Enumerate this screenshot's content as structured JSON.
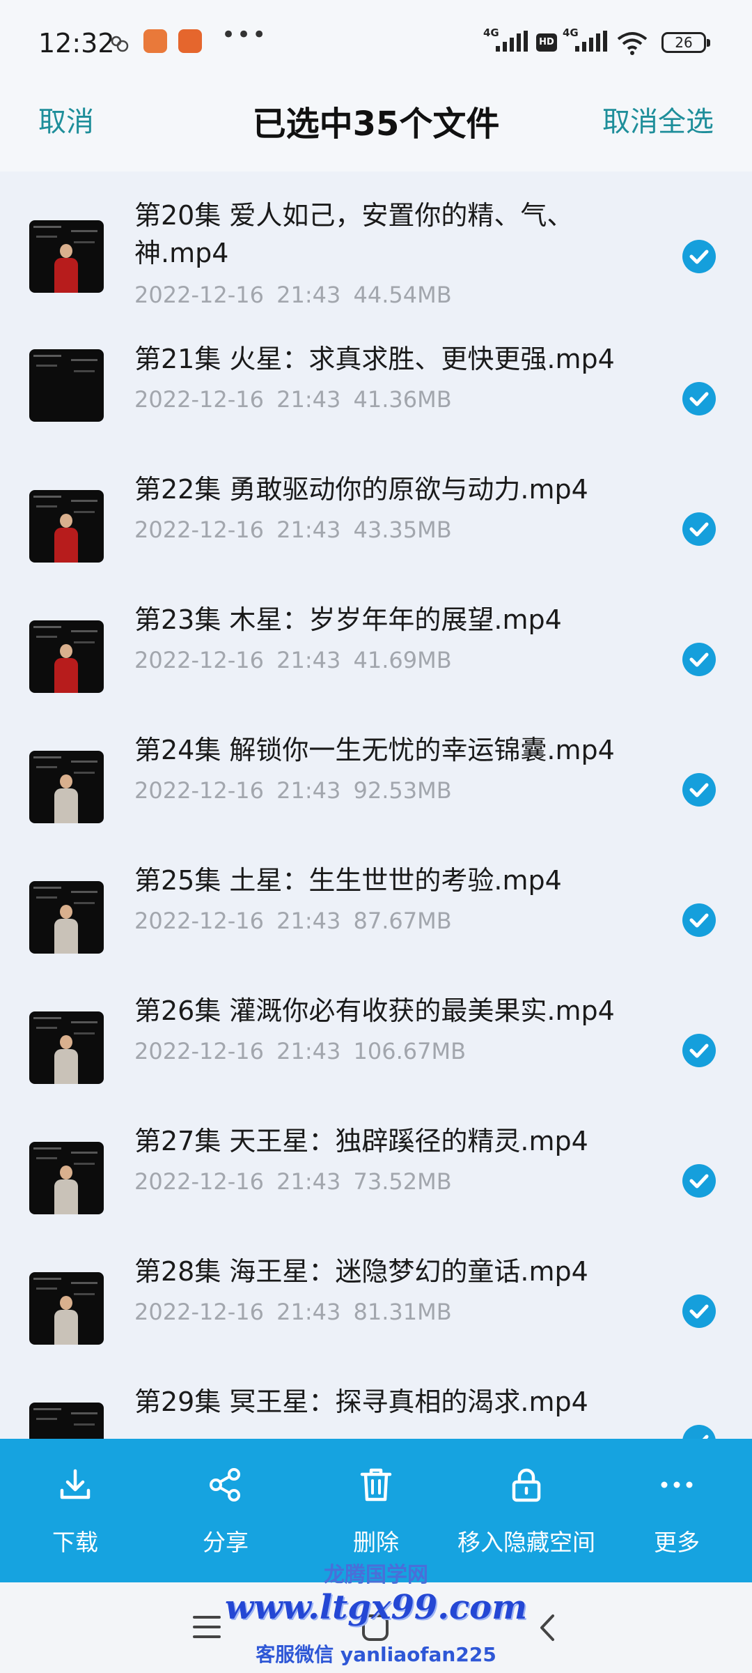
{
  "status_bar": {
    "time": "12:32",
    "net1": "4G",
    "net2": "4G",
    "hd": "HD",
    "battery": "26"
  },
  "header": {
    "cancel": "取消",
    "title": "已选中35个文件",
    "select_all_cancel": "取消全选"
  },
  "files": [
    {
      "name": "第20集 爱人如己，安置你的精、气、神.mp4",
      "date": "2022-12-16",
      "time": "21:43",
      "size": "44.54MB",
      "selected": true
    },
    {
      "name": "第21集 火星：求真求胜、更快更强.mp4",
      "date": "2022-12-16",
      "time": "21:43",
      "size": "41.36MB",
      "selected": true
    },
    {
      "name": "第22集 勇敢驱动你的原欲与动力.mp4",
      "date": "2022-12-16",
      "time": "21:43",
      "size": "43.35MB",
      "selected": true
    },
    {
      "name": "第23集 木星：岁岁年年的展望.mp4",
      "date": "2022-12-16",
      "time": "21:43",
      "size": "41.69MB",
      "selected": true
    },
    {
      "name": "第24集 解锁你一生无忧的幸运锦囊.mp4",
      "date": "2022-12-16",
      "time": "21:43",
      "size": "92.53MB",
      "selected": true
    },
    {
      "name": "第25集 土星：生生世世的考验.mp4",
      "date": "2022-12-16",
      "time": "21:43",
      "size": "87.67MB",
      "selected": true
    },
    {
      "name": "第26集 灌溉你必有收获的最美果实.mp4",
      "date": "2022-12-16",
      "time": "21:43",
      "size": "106.67MB",
      "selected": true
    },
    {
      "name": "第27集 天王星：独辟蹊径的精灵.mp4",
      "date": "2022-12-16",
      "time": "21:43",
      "size": "73.52MB",
      "selected": true
    },
    {
      "name": "第28集 海王星：迷隐梦幻的童话.mp4",
      "date": "2022-12-16",
      "time": "21:43",
      "size": "81.31MB",
      "selected": true
    },
    {
      "name": "第29集 冥王星：探寻真相的渴求.mp4",
      "date": "",
      "time": "",
      "size": "",
      "selected": true
    }
  ],
  "actions": {
    "download": "下载",
    "share": "分享",
    "delete": "删除",
    "move_hidden": "移入隐藏空间",
    "more": "更多"
  },
  "watermark": {
    "site": "龙腾国学网",
    "url": "www.ltgx99.com",
    "contact": "客服微信 yanliaofan225"
  },
  "colors": {
    "accent": "#16a3e0",
    "header_link": "#1e8e9a",
    "check": "#159fdc"
  }
}
